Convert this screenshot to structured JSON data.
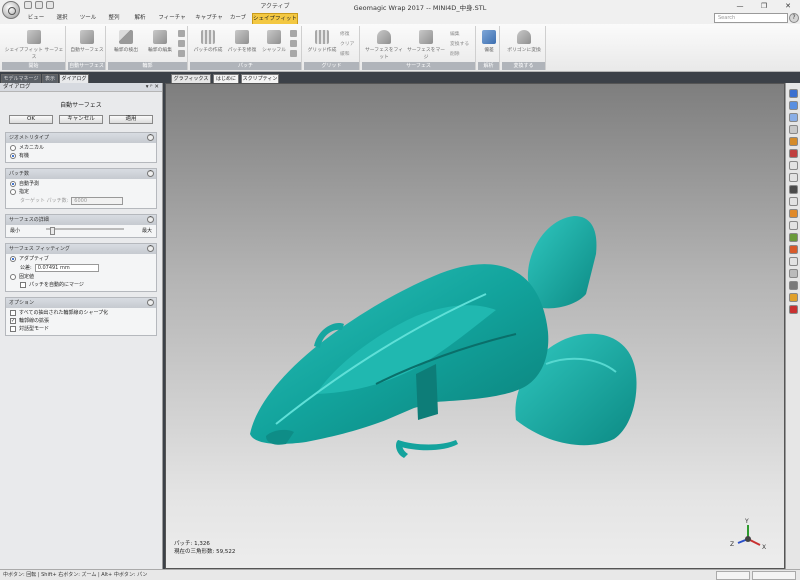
{
  "window": {
    "title": "Geomagic Wrap 2017 -- MINI4D_中身.STL",
    "context_group": "アクティブ",
    "minimize": "—",
    "restore": "❐",
    "close": "✕"
  },
  "ribbon_tabs": [
    "ビュー",
    "選択",
    "ツール",
    "整列",
    "解析",
    "フィーチャー",
    "キャプチャ",
    "カーブ",
    "シェイプフィット"
  ],
  "active_tab": "シェイプフィット",
  "search": {
    "placeholder": "Search"
  },
  "help_label": "?",
  "ribbon": {
    "groups": [
      {
        "label": "開始",
        "buttons": [
          "シェイプフィット サーフェス"
        ]
      },
      {
        "label": "自動サーフェス",
        "buttons": [
          "自動サーフェス"
        ]
      },
      {
        "label": "輪郭",
        "buttons": [
          "輪郭の検出",
          "輪郭の編集"
        ]
      },
      {
        "label": "パッチ",
        "buttons": [
          "パッチの作成",
          "パッチを修復",
          "シャッフル"
        ]
      },
      {
        "label": "グリッド",
        "buttons": [
          "グリッド作成"
        ],
        "small": [
          "修復",
          "クリア",
          "緩和"
        ]
      },
      {
        "label": "サーフェス",
        "buttons": [
          "サーフェスをフィット",
          "サーフェスをマージ"
        ],
        "small": [
          "編集",
          "変換する",
          "削除"
        ]
      },
      {
        "label": "解析",
        "buttons": [
          "偏差"
        ]
      },
      {
        "label": "変換する",
        "buttons": [
          "ポリゴンに変換"
        ]
      }
    ]
  },
  "left_tabs": [
    "モデルマネージャ",
    "表示",
    "ダイアログ"
  ],
  "active_left_tab": "ダイアログ",
  "panel": {
    "header": "ダイアログ",
    "header_controls": "▾ ᵖ ✕",
    "title": "自動サーフェス",
    "ok": "OK",
    "cancel": "キャンセル",
    "apply": "適用",
    "collapse_symbol": "⌃",
    "geometry_type": {
      "head": "ジオメトリタイプ",
      "options": [
        "メカニカル",
        "有機"
      ],
      "selected": "有機"
    },
    "patch_count": {
      "head": "パッチ数",
      "options": [
        "自動予測",
        "指定"
      ],
      "selected": "自動予測",
      "target_label": "ターゲット パッチ数:",
      "target_value": "6000"
    },
    "surface_detail": {
      "head": "サーフェスの詳細",
      "min_label": "最小",
      "max_label": "最大"
    },
    "surface_fitting": {
      "head": "サーフェス フィッティング",
      "adaptive": "アダプティブ",
      "tolerance_label": "公差:",
      "tolerance_value": "0.07491 mm",
      "fixed": "固定値",
      "merge_label": "パッチを自動的にマージ"
    },
    "options": {
      "head": "オプション",
      "items": [
        {
          "label": "すべての抽出された輪郭線のシャープ化",
          "checked": false
        },
        {
          "label": "輪郭線の拡張",
          "checked": true
        },
        {
          "label": "対話型モード",
          "checked": false
        }
      ]
    }
  },
  "graphics_tabs": [
    "グラフィックス",
    "はじめに",
    "スクリプティング"
  ],
  "viewport": {
    "stat_patches": "パッチ: 1,326",
    "stat_triangles": "現在の三角形数: 59,522",
    "axis_x": "X",
    "axis_y": "Y",
    "axis_z": "Z",
    "model_color": "#12a39c"
  },
  "status_bar": "中ボタン: 回転 | Shift+ 右ボタン: ズーム | Alt+ 中ボタン: パン"
}
